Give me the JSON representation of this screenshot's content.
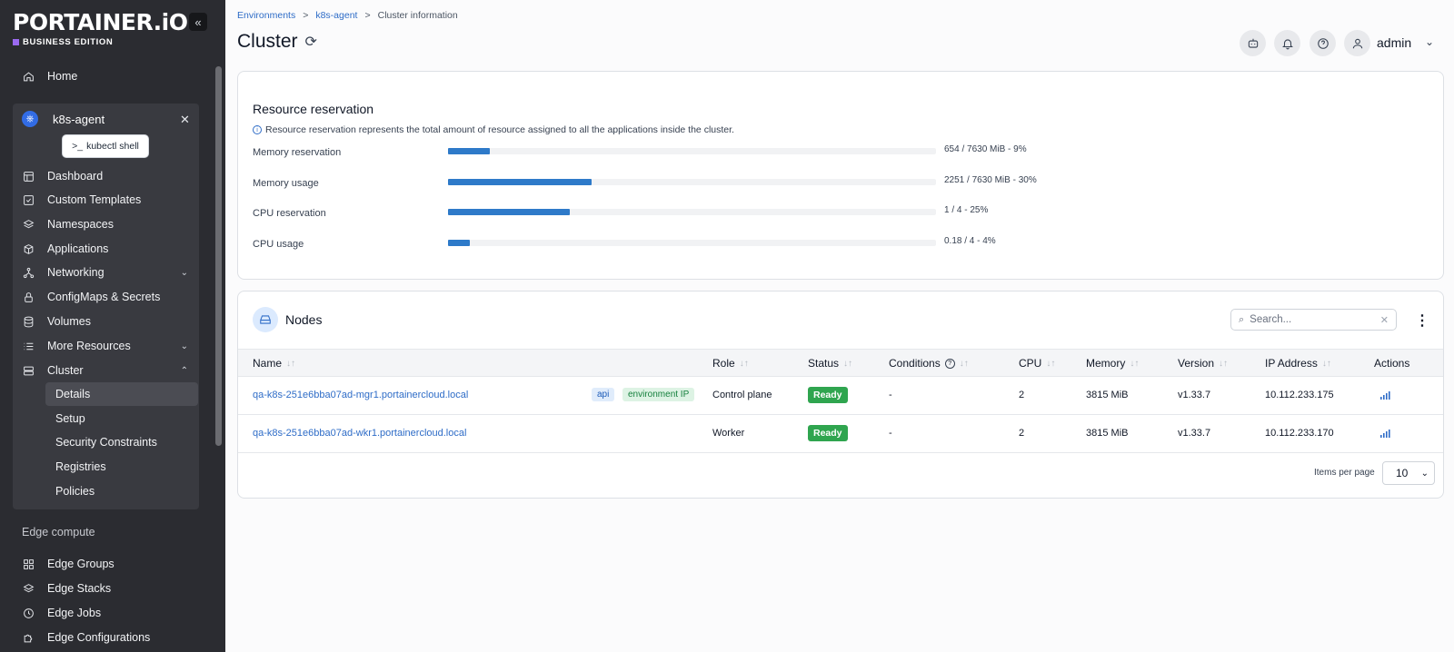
{
  "sidebar": {
    "logo": "PORTAINER.iO",
    "edition": "BUSINESS EDITION",
    "home": "Home",
    "environment": {
      "name": "k8s-agent",
      "kubectl": "kubectl shell"
    },
    "items": [
      {
        "label": "Dashboard",
        "icon": "dashboard-icon"
      },
      {
        "label": "Custom Templates",
        "icon": "templates-icon"
      },
      {
        "label": "Namespaces",
        "icon": "layers-icon"
      },
      {
        "label": "Applications",
        "icon": "box-icon"
      },
      {
        "label": "Networking",
        "icon": "network-icon"
      },
      {
        "label": "ConfigMaps & Secrets",
        "icon": "lock-icon"
      },
      {
        "label": "Volumes",
        "icon": "database-icon"
      },
      {
        "label": "More Resources",
        "icon": "list-icon"
      },
      {
        "label": "Cluster",
        "icon": "server-icon"
      }
    ],
    "cluster_sub": [
      "Details",
      "Setup",
      "Security Constraints",
      "Registries",
      "Policies"
    ],
    "edge_section": "Edge compute",
    "edge_items": [
      "Edge Groups",
      "Edge Stacks",
      "Edge Jobs",
      "Edge Configurations"
    ]
  },
  "breadcrumb": {
    "environments": "Environments",
    "env": "k8s-agent",
    "current": "Cluster information",
    "sep": ">"
  },
  "page": {
    "title": "Cluster"
  },
  "header": {
    "user": "admin"
  },
  "resource_reservation": {
    "title": "Resource reservation",
    "info": "Resource reservation represents the total amount of resource assigned to all the applications inside the cluster.",
    "rows": [
      {
        "label": "Memory reservation",
        "value": "654 / 7630 MiB - 9%",
        "fraction": 0.086
      },
      {
        "label": "Memory usage",
        "value": "2251 / 7630 MiB - 30%",
        "fraction": 0.295
      },
      {
        "label": "CPU reservation",
        "value": "1 / 4 - 25%",
        "fraction": 0.25
      },
      {
        "label": "CPU usage",
        "value": "0.18 / 4 - 4%",
        "fraction": 0.045
      }
    ]
  },
  "nodes": {
    "title": "Nodes",
    "search_placeholder": "Search...",
    "columns": [
      "Name",
      "Role",
      "Status",
      "Conditions",
      "CPU",
      "Memory",
      "Version",
      "IP Address",
      "Actions"
    ],
    "rows": [
      {
        "name": "qa-k8s-251e6bba07ad-mgr1.portainercloud.local",
        "badges": [
          "api",
          "environment IP"
        ],
        "role": "Control plane",
        "status": "Ready",
        "conditions": "-",
        "cpu": "2",
        "memory": "3815 MiB",
        "version": "v1.33.7",
        "ip": "10.112.233.175"
      },
      {
        "name": "qa-k8s-251e6bba07ad-wkr1.portainercloud.local",
        "badges": [],
        "role": "Worker",
        "status": "Ready",
        "conditions": "-",
        "cpu": "2",
        "memory": "3815 MiB",
        "version": "v1.33.7",
        "ip": "10.112.233.170"
      }
    ],
    "items_per_page_label": "Items per page",
    "items_per_page": "10"
  }
}
